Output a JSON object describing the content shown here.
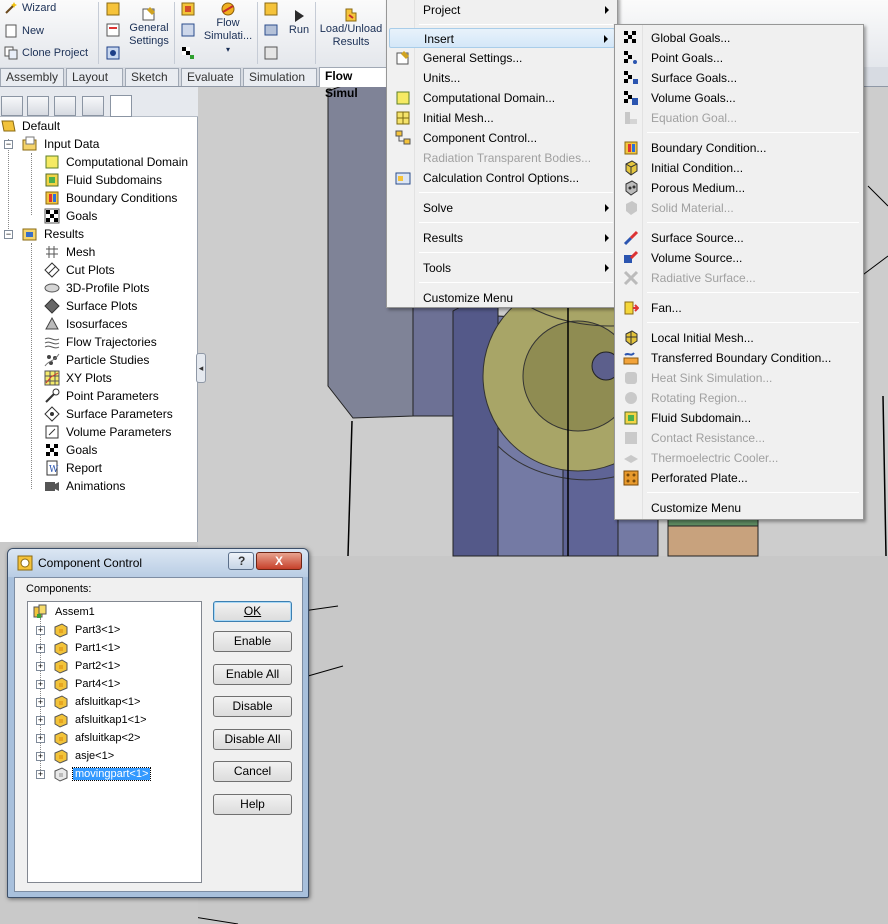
{
  "ribbon": {
    "wizard": "Wizard",
    "new": "New",
    "clone_project": "Clone Project",
    "general_settings": [
      "General",
      "Settings"
    ],
    "flow_simulation": [
      "Flow",
      "Simulati..."
    ],
    "run": "Run",
    "load_unload": [
      "Load/Unload",
      "Results"
    ]
  },
  "tabs": [
    "Assembly",
    "Layout",
    "Sketch",
    "Evaluate",
    "Simulation",
    "Flow Simul"
  ],
  "tree": {
    "root": "Default",
    "input_data": "Input Data",
    "input_children": [
      "Computational Domain",
      "Fluid Subdomains",
      "Boundary Conditions",
      "Goals"
    ],
    "results": "Results",
    "results_children": [
      "Mesh",
      "Cut Plots",
      "3D-Profile Plots",
      "Surface Plots",
      "Isosurfaces",
      "Flow Trajectories",
      "Particle Studies",
      "XY Plots",
      "Point Parameters",
      "Surface Parameters",
      "Volume Parameters",
      "Goals",
      "Report",
      "Animations"
    ]
  },
  "flow_menu": {
    "items": [
      {
        "label": "Project",
        "submenu": true,
        "enabled": true
      },
      {
        "label": "Insert",
        "submenu": true,
        "enabled": true,
        "highlight": true
      },
      {
        "label": "General Settings...",
        "enabled": true
      },
      {
        "label": "Units...",
        "enabled": true
      },
      {
        "label": "Computational Domain...",
        "enabled": true
      },
      {
        "label": "Initial Mesh...",
        "enabled": true
      },
      {
        "label": "Component Control...",
        "enabled": true
      },
      {
        "label": "Radiation Transparent Bodies...",
        "enabled": false
      },
      {
        "label": "Calculation Control Options...",
        "enabled": true
      },
      {
        "label": "Solve",
        "submenu": true,
        "enabled": true
      },
      {
        "label": "Results",
        "submenu": true,
        "enabled": true
      },
      {
        "label": "Tools",
        "submenu": true,
        "enabled": true
      },
      {
        "label": "Customize Menu",
        "enabled": true
      }
    ]
  },
  "insert_menu": {
    "items": [
      {
        "label": "Global Goals...",
        "enabled": true
      },
      {
        "label": "Point Goals...",
        "enabled": true
      },
      {
        "label": "Surface Goals...",
        "enabled": true
      },
      {
        "label": "Volume Goals...",
        "enabled": true
      },
      {
        "label": "Equation Goal...",
        "enabled": false
      },
      {
        "label": "Boundary Condition...",
        "enabled": true
      },
      {
        "label": "Initial Condition...",
        "enabled": true
      },
      {
        "label": "Porous Medium...",
        "enabled": true
      },
      {
        "label": "Solid Material...",
        "enabled": false
      },
      {
        "label": "Surface Source...",
        "enabled": true
      },
      {
        "label": "Volume Source...",
        "enabled": true
      },
      {
        "label": "Radiative Surface...",
        "enabled": false
      },
      {
        "label": "Fan...",
        "enabled": true
      },
      {
        "label": "Local Initial Mesh...",
        "enabled": true
      },
      {
        "label": "Transferred Boundary Condition...",
        "enabled": true
      },
      {
        "label": "Heat Sink Simulation...",
        "enabled": false
      },
      {
        "label": "Rotating Region...",
        "enabled": false
      },
      {
        "label": "Fluid Subdomain...",
        "enabled": true
      },
      {
        "label": "Contact Resistance...",
        "enabled": false
      },
      {
        "label": "Thermoelectric Cooler...",
        "enabled": false
      },
      {
        "label": "Perforated Plate...",
        "enabled": true
      },
      {
        "label": "Customize Menu",
        "enabled": true
      }
    ]
  },
  "dialog": {
    "title": "Component Control",
    "help_btn": "?",
    "close_btn": "X",
    "components_label": "Components:",
    "root": "Assem1",
    "parts": [
      "Part3<1>",
      "Part1<1>",
      "Part2<1>",
      "Part4<1>",
      "afsluitkap<1>",
      "afsluitkap1<1>",
      "afsluitkap<2>",
      "asje<1>",
      "movingpart<1>"
    ],
    "selected_index": 8,
    "buttons": {
      "ok": "OK",
      "enable": "Enable",
      "enable_all": "Enable All",
      "disable": "Disable",
      "disable_all": "Disable All",
      "cancel": "Cancel",
      "help": "Help"
    }
  },
  "colors": {
    "selection": "#3399ff",
    "menu_bg": "#f0f0f0",
    "dialog_frame": "#a8c0dc",
    "model_blue": "#6a6f9c",
    "gear": "#9c9a58"
  }
}
